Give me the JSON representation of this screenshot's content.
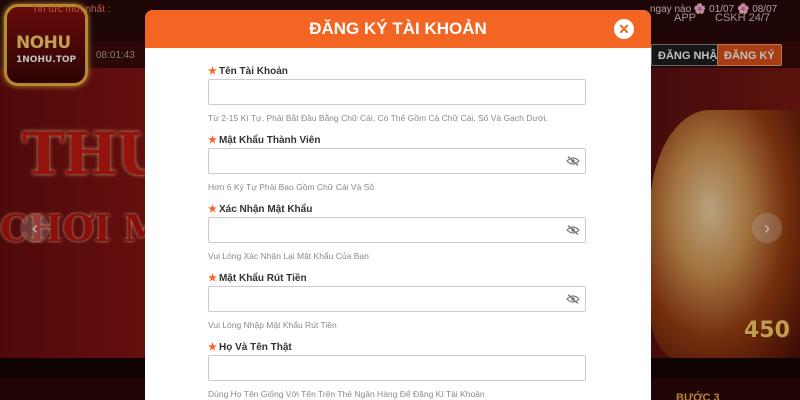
{
  "site": {
    "logo_main": "NOHU",
    "logo_sub": "1NOHU.TOP",
    "nav": {
      "app": "APP",
      "support": "CSKH 24/7"
    },
    "time": "08:01:43",
    "header_buttons": {
      "login": "ĐĂNG NHẬP",
      "register": "ĐĂNG KÝ"
    },
    "banner": {
      "line1": "THƯỞ",
      "line2": "CHƠI MỖI N",
      "prize": "450"
    },
    "ticker": {
      "label": "Tin tức mới nhất :",
      "right": "ngay nào 🌸 01/07 🌸 08/07"
    },
    "bottom_text": "BƯỚC 3"
  },
  "modal": {
    "title": "ĐĂNG KÝ TÀI KHOẢN",
    "close_icon": "close-icon",
    "accent_color": "#f26522",
    "fields": [
      {
        "label": "Tên Tài Khoản",
        "value": "",
        "hint": "Từ 2-15 Kí Tự, Phải Bắt Đầu Bằng Chữ Cái, Có Thể Gồm Cả Chữ Cái, Số Và Gạch Dưới."
      },
      {
        "label": "Mật Khẩu Thành Viên",
        "value": "",
        "hint": "Hơn 6 Ký Tự Phải Bao Gồm Chữ Cái Và Số"
      },
      {
        "label": "Xác Nhận Mật Khẩu",
        "value": "",
        "hint": "Vui Lòng Xác Nhận Lại Mật Khẩu Của Bạn"
      },
      {
        "label": "Mật Khẩu Rút Tiền",
        "value": "",
        "hint": "Vui Lòng Nhập Mật Khẩu Rút Tiền"
      },
      {
        "label": "Họ Và Tên Thật",
        "value": "",
        "hint": "Dùng Họ Tên Giống Với Tên Trên Thẻ Ngân Hàng Để Đăng Kí Tài Khoản"
      }
    ]
  }
}
